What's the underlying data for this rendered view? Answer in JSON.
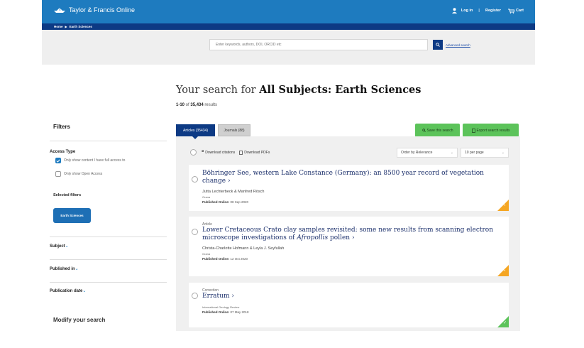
{
  "header": {
    "logo_text": "Taylor & Francis Online",
    "login": "Log in",
    "separator": "|",
    "register": "Register",
    "cart": "Cart"
  },
  "breadcrumb": {
    "home": "Home",
    "arrow": "▶",
    "current": "Earth Sciences"
  },
  "search": {
    "placeholder": "Enter keywords, authors, DOI, ORCID etc",
    "advanced": "Advanced search"
  },
  "results": {
    "heading_prefix": "Your search for ",
    "heading_subject": "All Subjects: Earth Sciences",
    "range": "1-10",
    "of": " of ",
    "total": "35,434",
    "results_word": " results"
  },
  "sidebar": {
    "filters": "Filters",
    "access_type": "Access Type",
    "option_full_access": "Only show content I have full access to",
    "option_open_access": "Only show Open Access",
    "selected_filters": "Selected filters",
    "chip": "Earth Sciences",
    "subject": "Subject",
    "published_in": "Published in",
    "publication_date": "Publication date",
    "modify": "Modify your search"
  },
  "tabs": {
    "articles": "Articles (35434)",
    "journals": "Journals (88)"
  },
  "actions": {
    "save": "Save this search",
    "export": "Export search results",
    "download_citations": "Download citations",
    "download_pdfs": "Download PDFs",
    "order": "Order by Relevance",
    "per_page": "10 per page"
  },
  "cards": [
    {
      "type": "",
      "title": "Böhringer See, western Lake Constance (Germany): an 8500 year record of vegetation change",
      "authors": "Jutta Lechterbeck & Manfred Rösch",
      "journal": "Grana",
      "published_label": "Published Online:",
      "published_date": "08 Sep 2020"
    },
    {
      "type": "Article",
      "title_part1": "Lower Cretaceous Crato clay samples revisited: some new results from scanning electron microscope investigations of ",
      "title_italic": "Afropollis",
      "title_part2": " pollen",
      "authors": "Christa-Charlotte Hofmann & Leyla J. Seyfullah",
      "journal": "Grana",
      "published_label": "Published Online:",
      "published_date": "12 Oct 2020"
    },
    {
      "type": "Correction",
      "title": "Erratum",
      "journal": "International Geology Review",
      "published_label": "Published Online:",
      "published_date": "07 May 2018"
    }
  ],
  "colors": {
    "brand_blue": "#1e7bbf",
    "navy": "#0d3a84",
    "green": "#5cc35a",
    "orange": "#f5a623"
  }
}
